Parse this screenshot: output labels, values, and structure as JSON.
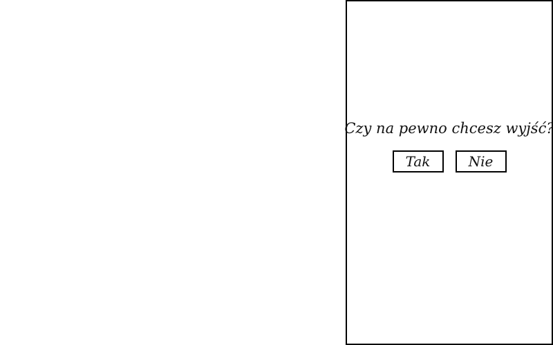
{
  "dialog": {
    "prompt": "Czy na pewno chcesz wyjść?",
    "confirm_label": "Tak",
    "cancel_label": "Nie"
  },
  "colors": {
    "border": "#000000",
    "background": "#ffffff",
    "text": "#111111"
  }
}
